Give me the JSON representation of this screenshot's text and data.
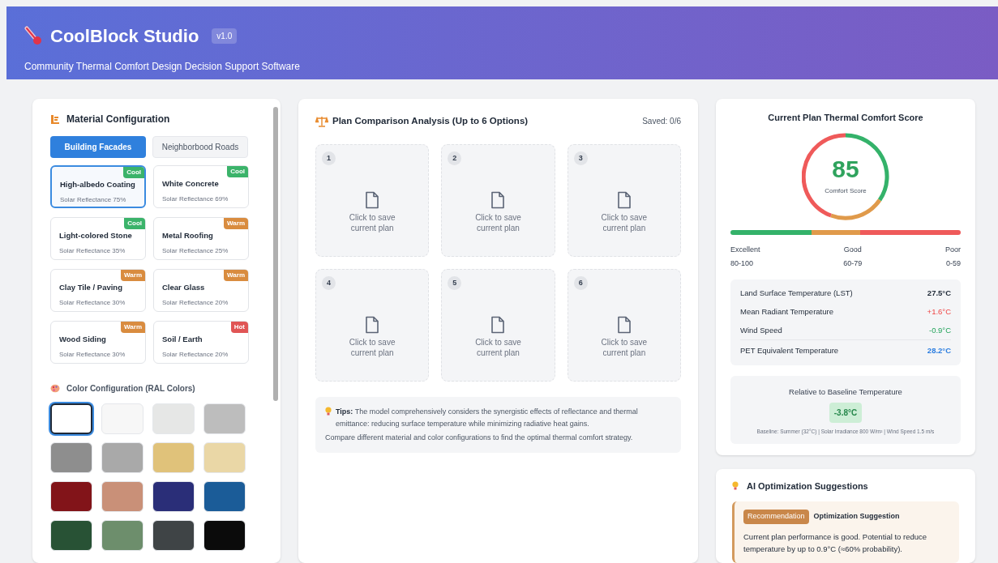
{
  "header": {
    "title": "CoolBlock Studio",
    "version": "v1.0",
    "subtitle": "Community Thermal Comfort Design Decision Support Software"
  },
  "materials": {
    "title": "Material Configuration",
    "tabs": [
      {
        "label": "Building Facades",
        "selected": true
      },
      {
        "label": "Neighborbood Roads",
        "selected": false
      }
    ],
    "items": [
      {
        "name": "High-albedo Coating",
        "reflectance": "Solar Reflectance 75%",
        "tag": "Cool",
        "color": "#3bb36a",
        "selected": true
      },
      {
        "name": "White Concrete",
        "reflectance": "Solar Reflectance 69%",
        "tag": "Cool",
        "color": "#3bb36a",
        "selected": false
      },
      {
        "name": "Light-colored Stone",
        "reflectance": "Solar Reflectance 35%",
        "tag": "Cool",
        "color": "#3bb36a",
        "selected": false
      },
      {
        "name": "Metal Roofing",
        "reflectance": "Solar Reflectance 25%",
        "tag": "Warm",
        "color": "#d98c3f",
        "selected": false
      },
      {
        "name": "Clay Tile / Paving",
        "reflectance": "Solar Reflectance 30%",
        "tag": "Warm",
        "color": "#d98c3f",
        "selected": false
      },
      {
        "name": "Clear Glass",
        "reflectance": "Solar Reflectance 20%",
        "tag": "Warm",
        "color": "#d98c3f",
        "selected": false
      },
      {
        "name": "Wood Siding",
        "reflectance": "Solar Reflectance 30%",
        "tag": "Warm",
        "color": "#d98c3f",
        "selected": false
      },
      {
        "name": "Soil / Earth",
        "reflectance": "Solar Reflectance 20%",
        "tag": "Hot",
        "color": "#e05555",
        "selected": false
      }
    ],
    "colors_title": "Color Configuration (RAL Colors)",
    "swatches": [
      {
        "color": "#ffffff",
        "selected": true
      },
      {
        "color": "#f7f7f7",
        "selected": false
      },
      {
        "color": "#e6e7e6",
        "selected": false
      },
      {
        "color": "#bdbdbd",
        "selected": false
      },
      {
        "color": "#8e8e8e",
        "selected": false
      },
      {
        "color": "#a9a9a9",
        "selected": false
      },
      {
        "color": "#e0c27a",
        "selected": false
      },
      {
        "color": "#ead7a6",
        "selected": false
      },
      {
        "color": "#821419",
        "selected": false
      },
      {
        "color": "#c99078",
        "selected": false
      },
      {
        "color": "#2a2e78",
        "selected": false
      },
      {
        "color": "#1b5c98",
        "selected": false
      },
      {
        "color": "#285235",
        "selected": false
      },
      {
        "color": "#6d8e6c",
        "selected": false
      },
      {
        "color": "#3f4446",
        "selected": false
      },
      {
        "color": "#0b0b0b",
        "selected": false
      }
    ]
  },
  "comparison": {
    "title": "Plan Comparison Analysis (Up to 6 Options)",
    "saved": "Saved: 0/6",
    "slots": [
      {
        "number": "1",
        "label": "Click to save current plan"
      },
      {
        "number": "2",
        "label": "Click to save current plan"
      },
      {
        "number": "3",
        "label": "Click to save current plan"
      },
      {
        "number": "4",
        "label": "Click to save current plan"
      },
      {
        "number": "5",
        "label": "Click to save current plan"
      },
      {
        "number": "6",
        "label": "Click to save current plan"
      }
    ],
    "tips": [
      "**Tips:** The model comprehensively considers the synergistic effects of reflectance and thermal emittance: reducing surface temperature while minimizing radiative heat gains.",
      "Compare different material and color configurations to find the optimal thermal comfort strategy."
    ]
  },
  "score": {
    "title": "Current Plan Thermal Comfort Score",
    "value": "85",
    "caption": "Comfort Score",
    "ranges": [
      {
        "label": "Excellent",
        "range": "80-100"
      },
      {
        "label": "Good",
        "range": "60-79"
      },
      {
        "label": "Poor",
        "range": "0-59"
      }
    ],
    "metrics": [
      {
        "label": "Land Surface Temperature (LST)",
        "value": "27.5°C",
        "kind": "neutral"
      },
      {
        "label": "Mean Radiant Temperature",
        "value": "+1.6°C",
        "kind": "rise"
      },
      {
        "label": "Wind Speed",
        "value": "-0.9°C",
        "kind": "drop"
      },
      {
        "label": "PET Equivalent Temperature",
        "value": "28.2°C",
        "kind": "total"
      }
    ],
    "baseline": {
      "title": "Relative to Baseline Temperature",
      "delta": "-3.8°C",
      "note": "Baseline: Summer (32°C) | Solar Irradiance 800 W/m² | Wind Speed 1.5 m/s"
    }
  },
  "suggestions": {
    "title": "AI Optimization Suggestions",
    "badge": "Recommendation",
    "heading": "Optimization Suggestion",
    "text": "Current plan performance is good. Potential to reduce temperature by up to 0.9°C (≈60% probability)."
  }
}
